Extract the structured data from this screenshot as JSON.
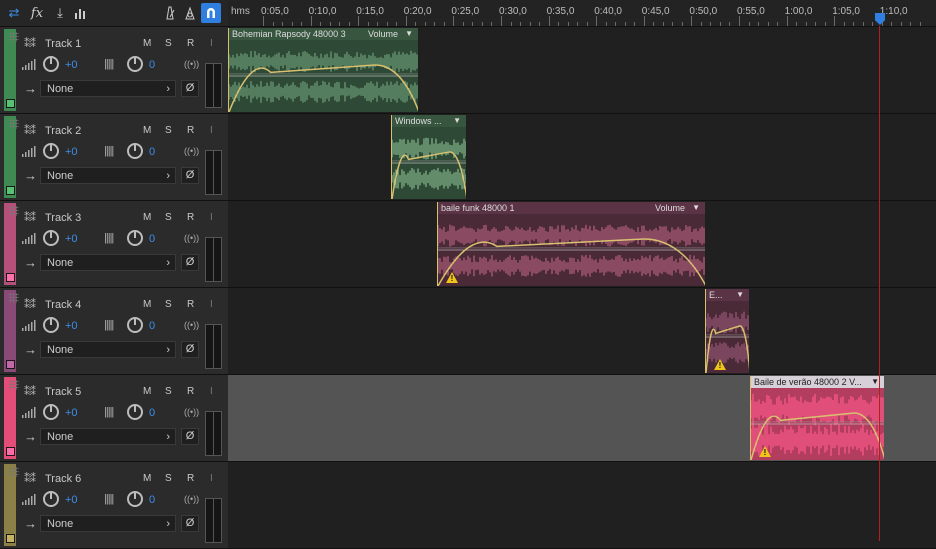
{
  "toolbar": {
    "icons": [
      "switch-icon",
      "fx-icon",
      "input-icon",
      "levels-icon",
      "metronome-icon",
      "snap-icon",
      "magnet-icon"
    ],
    "fx_label": "fx"
  },
  "ruler": {
    "unit_label": "hms",
    "ticks": [
      "0:05,0",
      "0:10,0",
      "0:15,0",
      "0:20,0",
      "0:25,0",
      "0:30,0",
      "0:35,0",
      "0:40,0",
      "0:45,0",
      "0:50,0",
      "0:55,0",
      "1:00,0",
      "1:05,0",
      "1:10,0"
    ]
  },
  "tracks": [
    {
      "name": "Track 1",
      "color": "#3f8a52",
      "mute": "M",
      "solo": "S",
      "record": "R",
      "input": "I",
      "volume": "+0",
      "pan": "0",
      "route": "None",
      "null": "Ø"
    },
    {
      "name": "Track 2",
      "color": "#3f8a52",
      "mute": "M",
      "solo": "S",
      "record": "R",
      "input": "I",
      "volume": "+0",
      "pan": "0",
      "route": "None",
      "null": "Ø"
    },
    {
      "name": "Track 3",
      "color": "#b5507a",
      "mute": "M",
      "solo": "S",
      "record": "R",
      "input": "I",
      "volume": "+0",
      "pan": "0",
      "route": "None",
      "null": "Ø"
    },
    {
      "name": "Track 4",
      "color": "#8a4a78",
      "mute": "M",
      "solo": "S",
      "record": "R",
      "input": "I",
      "volume": "+0",
      "pan": "0",
      "route": "None",
      "null": "Ø"
    },
    {
      "name": "Track 5",
      "color": "#e54d79",
      "mute": "M",
      "solo": "S",
      "record": "R",
      "input": "I",
      "volume": "+0",
      "pan": "0",
      "route": "None",
      "null": "Ø"
    },
    {
      "name": "Track 6",
      "color": "#8b8046",
      "mute": "M",
      "solo": "S",
      "record": "R",
      "input": "I",
      "volume": "+0",
      "pan": "0",
      "route": "None",
      "null": "Ø"
    }
  ],
  "clips": [
    {
      "track": 1,
      "name": "Bohemian Rapsody 48000 3",
      "envelope": "Volume",
      "color": "#2e4a36",
      "wave": "#6f9f78",
      "warning": false
    },
    {
      "track": 2,
      "name": "Windows ...",
      "envelope": "",
      "color": "#2e4a36",
      "wave": "#86b98d",
      "warning": false
    },
    {
      "track": 3,
      "name": "baile funk 48000 1",
      "envelope": "Volume",
      "color": "#4a2a36",
      "wave": "#b5607e",
      "warning": true
    },
    {
      "track": 4,
      "name": "E...",
      "envelope": "",
      "color": "#4a2a36",
      "wave": "#9a5a7a",
      "warning": true
    },
    {
      "track": 5,
      "name": "Baile de verão 48000 2 V...",
      "envelope": "",
      "color": "#b33d5e",
      "wave": "#ff5a8c",
      "warning": true
    }
  ]
}
